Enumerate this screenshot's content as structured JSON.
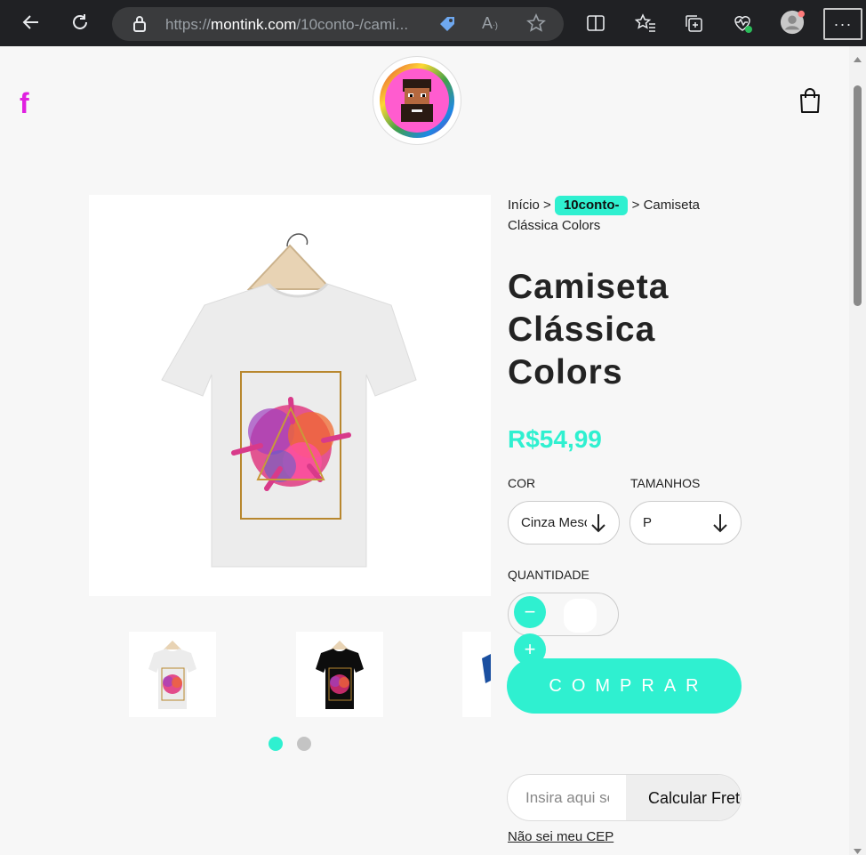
{
  "browser": {
    "url_domain": "montink.com",
    "url_rest": "/10conto-/cami...",
    "url_scheme": "https://"
  },
  "header": {
    "facebook_glyph": "f"
  },
  "breadcrumb": {
    "home": "Início",
    "sep1": ">",
    "category": "10conto-",
    "sep2": ">",
    "current": "Camiseta Clássica Colors"
  },
  "product": {
    "title": "Camiseta Clássica Colors",
    "price": "R$54,99"
  },
  "options": {
    "color_label": "COR",
    "color_value": "Cinza Mescla",
    "size_label": "TAMANHOS",
    "size_value": "P"
  },
  "quantity": {
    "label": "QUANTIDADE",
    "minus": "−",
    "plus": "+"
  },
  "buy_label": "COMPRAR",
  "shipping": {
    "placeholder": "Insira aqui seu CEP",
    "button": "Calcular Frete",
    "help_link": "Não sei meu CEP"
  },
  "gallery": {
    "active_dot": 0,
    "dot_count": 2
  },
  "colors": {
    "accent": "#2ff0d0",
    "facebook": "#e020e0"
  }
}
